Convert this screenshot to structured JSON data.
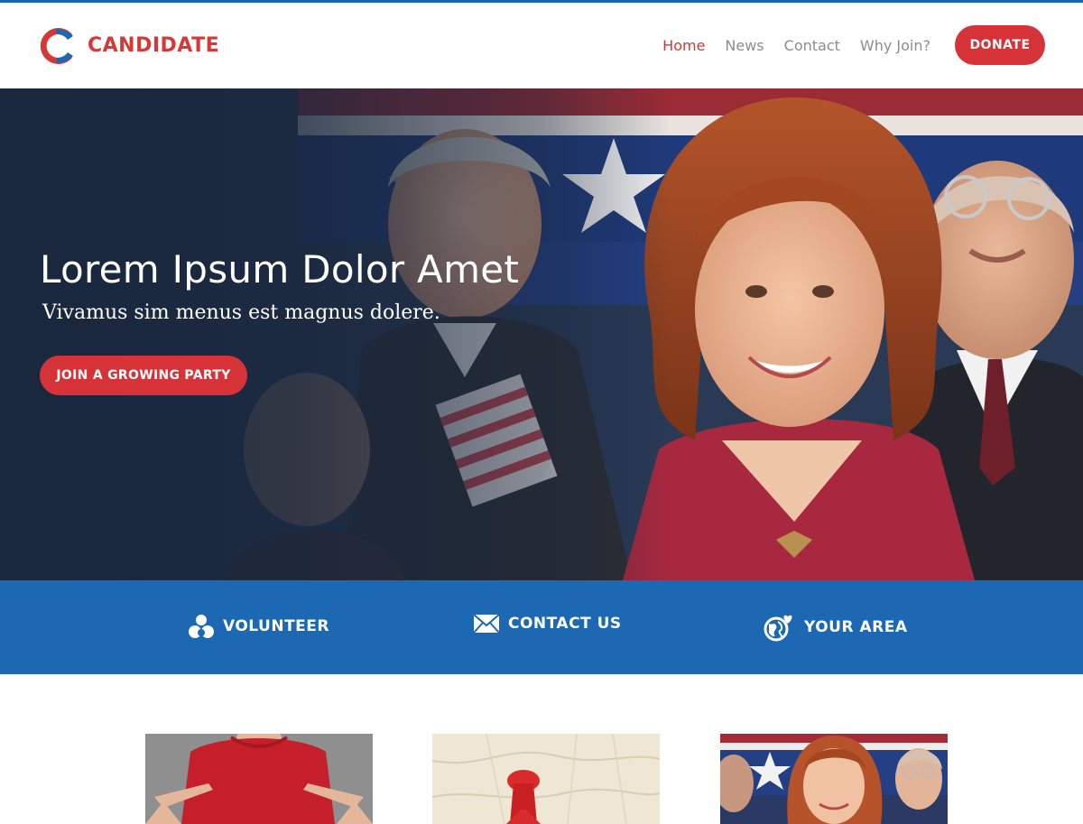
{
  "brand": {
    "name": "CANDIDATE",
    "primary": "#d63838",
    "accent": "#1c68b2"
  },
  "nav": {
    "items": [
      {
        "label": "Home",
        "active": true
      },
      {
        "label": "News",
        "active": false
      },
      {
        "label": "Contact",
        "active": false
      },
      {
        "label": "Why Join?",
        "active": false
      }
    ],
    "donate_label": "DONATE"
  },
  "hero": {
    "title": "Lorem Ipsum Dolor Amet",
    "subtitle": "Vivamus sim menus est magnus dolere.",
    "cta_label": "JOIN A GROWING PARTY"
  },
  "actions": [
    {
      "label": "VOLUNTEER",
      "icon": "volunteer-icon"
    },
    {
      "label": "CONTACT US",
      "icon": "envelope-icon"
    },
    {
      "label": "YOUR AREA",
      "icon": "globe-heart-icon"
    }
  ],
  "cards": [
    {
      "image": "red-shirt-photo"
    },
    {
      "image": "map-pin-photo"
    },
    {
      "image": "candidate-crowd-photo"
    }
  ]
}
